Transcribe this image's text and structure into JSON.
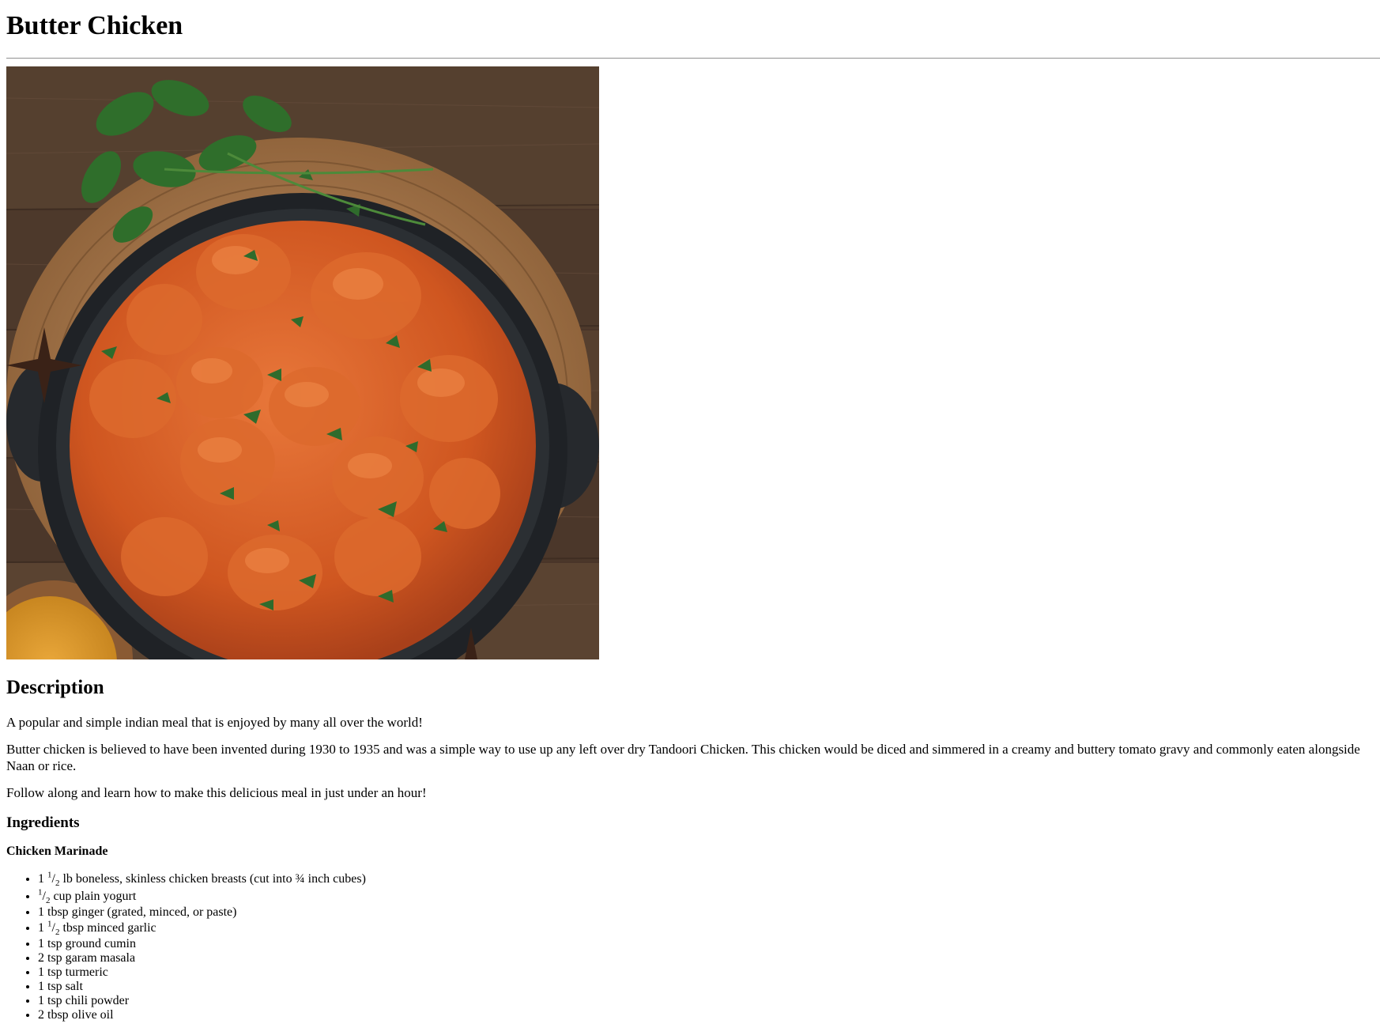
{
  "recipe": {
    "title": "Butter Chicken",
    "image_alt": "Butter Chicken",
    "description_heading": "Description",
    "description": [
      "A popular and simple indian meal that is enjoyed by many all over the world!",
      "Butter chicken is believed to have been invented during 1930 to 1935 and was a simple way to use up any left over dry Tandoori Chicken. This chicken would be diced and simmered in a creamy and buttery tomato gravy and commonly eaten alongside Naan or rice.",
      "Follow along and learn how to make this delicious meal in just under an hour!"
    ],
    "ingredients_heading": "Ingredients",
    "marinade_heading": "Chicken Marinade",
    "marinade_items": [
      {
        "whole": "1",
        "num": "1",
        "den": "2",
        "rest": "lb boneless, skinless chicken breasts (cut into ¾ inch cubes)"
      },
      {
        "whole": "",
        "num": "1",
        "den": "2",
        "rest": "cup plain yogurt"
      },
      {
        "whole": "",
        "num": "",
        "den": "",
        "rest": "1 tbsp ginger (grated, minced, or paste)"
      },
      {
        "whole": "1",
        "num": "1",
        "den": "2",
        "rest": "tbsp minced garlic"
      },
      {
        "whole": "",
        "num": "",
        "den": "",
        "rest": "1 tsp ground cumin"
      },
      {
        "whole": "",
        "num": "",
        "den": "",
        "rest": "2 tsp garam masala"
      },
      {
        "whole": "",
        "num": "",
        "den": "",
        "rest": "1 tsp turmeric"
      },
      {
        "whole": "",
        "num": "",
        "den": "",
        "rest": "1 tsp salt"
      },
      {
        "whole": "",
        "num": "",
        "den": "",
        "rest": "1 tsp chili powder"
      },
      {
        "whole": "",
        "num": "",
        "den": "",
        "rest": "2 tbsp olive oil"
      }
    ]
  },
  "colors": {
    "wood_dark": "#4a3529",
    "board": "#a87a4e",
    "pan": "#232528",
    "curry": "#d2581f",
    "curry_light": "#e8773a",
    "herb": "#2f6b2c",
    "turmeric": "#d99520"
  }
}
